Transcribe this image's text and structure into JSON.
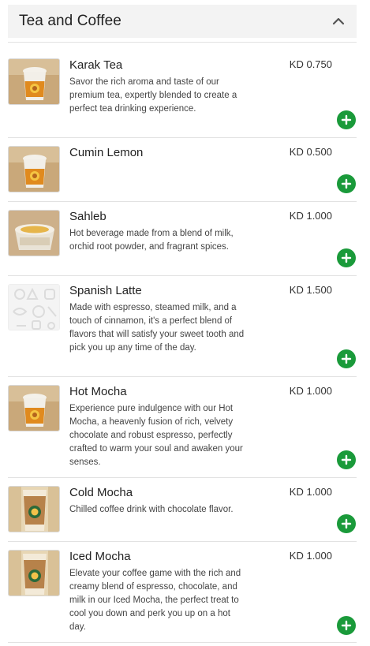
{
  "section": {
    "title": "Tea and Coffee"
  },
  "items": [
    {
      "name": "Karak Tea",
      "price": "KD 0.750",
      "description": "Savor the rich aroma and taste of our premium tea, expertly blended to create a perfect tea drinking experience.",
      "image": "cup-icon"
    },
    {
      "name": "Cumin Lemon",
      "price": "KD 0.500",
      "description": "",
      "image": "cup-icon"
    },
    {
      "name": "Sahleb",
      "price": "KD 1.000",
      "description": "Hot beverage made from a blend of milk, orchid root powder, and fragrant spices.",
      "image": "bowl-icon"
    },
    {
      "name": "Spanish Latte",
      "price": "KD 1.500",
      "description": "Made with espresso, steamed milk, and a touch of cinnamon, it's a perfect blend of flavors that will satisfy your sweet tooth and pick you up any time of the day.",
      "image": "placeholder-pattern"
    },
    {
      "name": "Hot Mocha",
      "price": "KD 1.000",
      "description": "Experience pure indulgence with our Hot Mocha, a heavenly fusion of rich, velvety chocolate and robust espresso, perfectly crafted to warm your soul and awaken your senses.",
      "image": "cup-icon"
    },
    {
      "name": "Cold Mocha",
      "price": "KD 1.000",
      "description": "Chilled coffee drink with chocolate flavor.",
      "image": "iced-cup-icon"
    },
    {
      "name": "Iced Mocha",
      "price": "KD 1.000",
      "description": "Elevate your coffee game with the rich and creamy blend of espresso, chocolate, and milk in our Iced Mocha, the perfect treat to cool you down and perk you up on a hot day.",
      "image": "iced-cup-icon"
    }
  ],
  "colors": {
    "add_button": "#1a9a3a",
    "header_bg": "#f3f3f3"
  }
}
